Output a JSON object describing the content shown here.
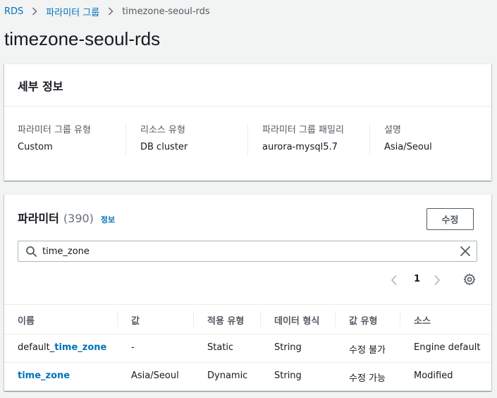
{
  "breadcrumb": {
    "items": [
      "RDS",
      "파라미터 그룹"
    ],
    "current": "timezone-seoul-rds"
  },
  "page_title": "timezone-seoul-rds",
  "details": {
    "header": "세부 정보",
    "fields": [
      {
        "label": "파라미터 그룹 유형",
        "value": "Custom"
      },
      {
        "label": "리소스 유형",
        "value": "DB cluster"
      },
      {
        "label": "파라미터 그룹 패밀리",
        "value": "aurora-mysql5.7"
      },
      {
        "label": "설명",
        "value": "Asia/Seoul"
      }
    ]
  },
  "parameters": {
    "title": "파라미터",
    "count": "(390)",
    "info_label": "정보",
    "edit_label": "수정",
    "search_value": "time_zone",
    "page": "1",
    "columns": [
      "이름",
      "값",
      "적용 유형",
      "데이터 형식",
      "값 유형",
      "소스"
    ],
    "rows": [
      {
        "name_prefix": "default_",
        "name_match": "time_zone",
        "value": "-",
        "apply_type": "Static",
        "data_type": "String",
        "value_type": "수정 불가",
        "source": "Engine default"
      },
      {
        "name_prefix": "",
        "name_match": "time_zone",
        "value": "Asia/Seoul",
        "apply_type": "Dynamic",
        "data_type": "String",
        "value_type": "수정 가능",
        "source": "Modified"
      }
    ]
  },
  "colors": {
    "link": "#0073bb",
    "background": "#f2f3f3",
    "text": "#16191f",
    "muted": "#545b64"
  },
  "icons": {
    "search": "search-icon",
    "clear": "close-icon",
    "prev": "chevron-left-icon",
    "next": "chevron-right-icon",
    "settings": "gear-icon",
    "separator": "chevron-right-icon"
  }
}
